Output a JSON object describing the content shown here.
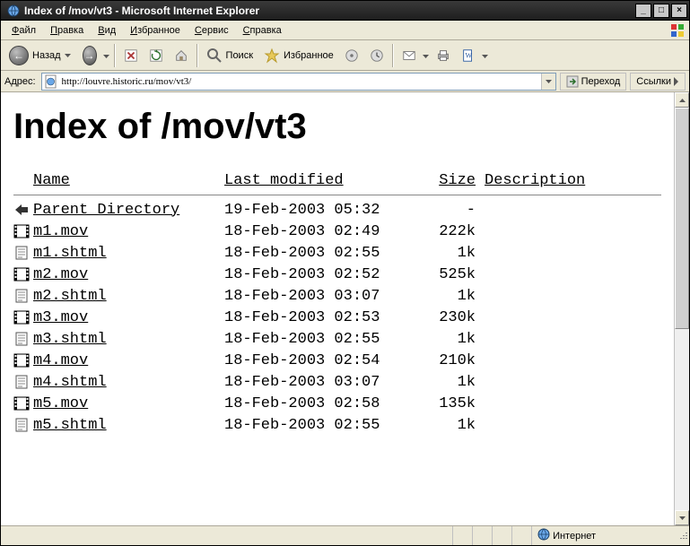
{
  "window": {
    "title": "Index of /mov/vt3 - Microsoft Internet Explorer"
  },
  "menu": {
    "file": {
      "label": "Файл",
      "underline_index": 0
    },
    "edit": {
      "label": "Правка",
      "underline_index": 0
    },
    "view": {
      "label": "Вид",
      "underline_index": 0
    },
    "fav": {
      "label": "Избранное",
      "underline_index": 0
    },
    "tools": {
      "label": "Сервис",
      "underline_index": 0
    },
    "help": {
      "label": "Справка",
      "underline_index": 0
    }
  },
  "toolbar": {
    "back": "Назад",
    "search": "Поиск",
    "favorites": "Избранное"
  },
  "address": {
    "label": "Адрес:",
    "url": "http://louvre.historic.ru/mov/vt3/",
    "go": "Переход",
    "links": "Ссылки"
  },
  "page": {
    "heading": "Index of /mov/vt3",
    "columns": {
      "name": "Name",
      "modified": "Last modified",
      "size": "Size",
      "desc": "Description"
    },
    "rows": [
      {
        "icon": "back",
        "name": "Parent Directory",
        "modified": "19-Feb-2003 05:32",
        "size": "-"
      },
      {
        "icon": "movie",
        "name": "m1.mov",
        "modified": "18-Feb-2003 02:49",
        "size": "222k"
      },
      {
        "icon": "text",
        "name": "m1.shtml",
        "modified": "18-Feb-2003 02:55",
        "size": "1k"
      },
      {
        "icon": "movie",
        "name": "m2.mov",
        "modified": "18-Feb-2003 02:52",
        "size": "525k"
      },
      {
        "icon": "text",
        "name": "m2.shtml",
        "modified": "18-Feb-2003 03:07",
        "size": "1k"
      },
      {
        "icon": "movie",
        "name": "m3.mov",
        "modified": "18-Feb-2003 02:53",
        "size": "230k"
      },
      {
        "icon": "text",
        "name": "m3.shtml",
        "modified": "18-Feb-2003 02:55",
        "size": "1k"
      },
      {
        "icon": "movie",
        "name": "m4.mov",
        "modified": "18-Feb-2003 02:54",
        "size": "210k"
      },
      {
        "icon": "text",
        "name": "m4.shtml",
        "modified": "18-Feb-2003 03:07",
        "size": "1k"
      },
      {
        "icon": "movie",
        "name": "m5.mov",
        "modified": "18-Feb-2003 02:58",
        "size": "135k"
      },
      {
        "icon": "text",
        "name": "m5.shtml",
        "modified": "18-Feb-2003 02:55",
        "size": "1k"
      }
    ]
  },
  "status": {
    "zone": "Интернет"
  }
}
